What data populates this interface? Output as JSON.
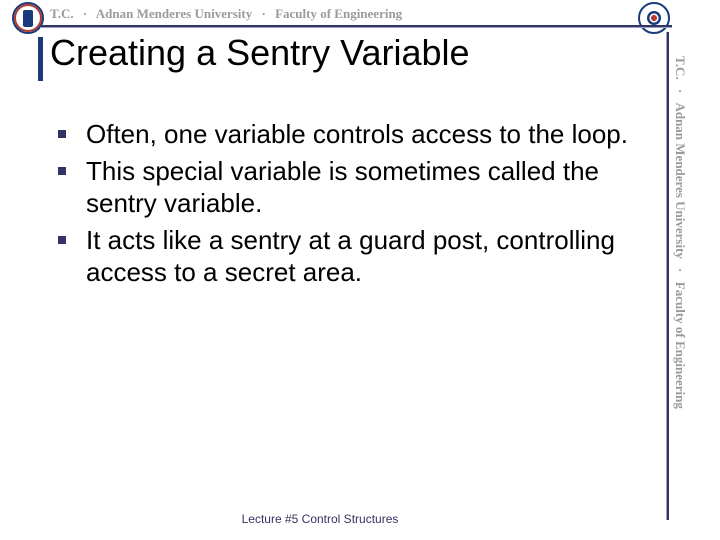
{
  "header": {
    "banner_tc": "T.C.",
    "banner_univ": "Adnan Menderes University",
    "banner_faculty": "Faculty of Engineering",
    "logo_left_name": "university-seal",
    "logo_right_name": "faculty-seal"
  },
  "title": "Creating a Sentry Variable",
  "bullets": [
    "Often, one variable controls access to the loop.",
    "This special variable is sometimes called the sentry variable.",
    "It acts like a sentry at a guard post, controlling access to a secret area."
  ],
  "footer": "Lecture #5 Control Structures"
}
